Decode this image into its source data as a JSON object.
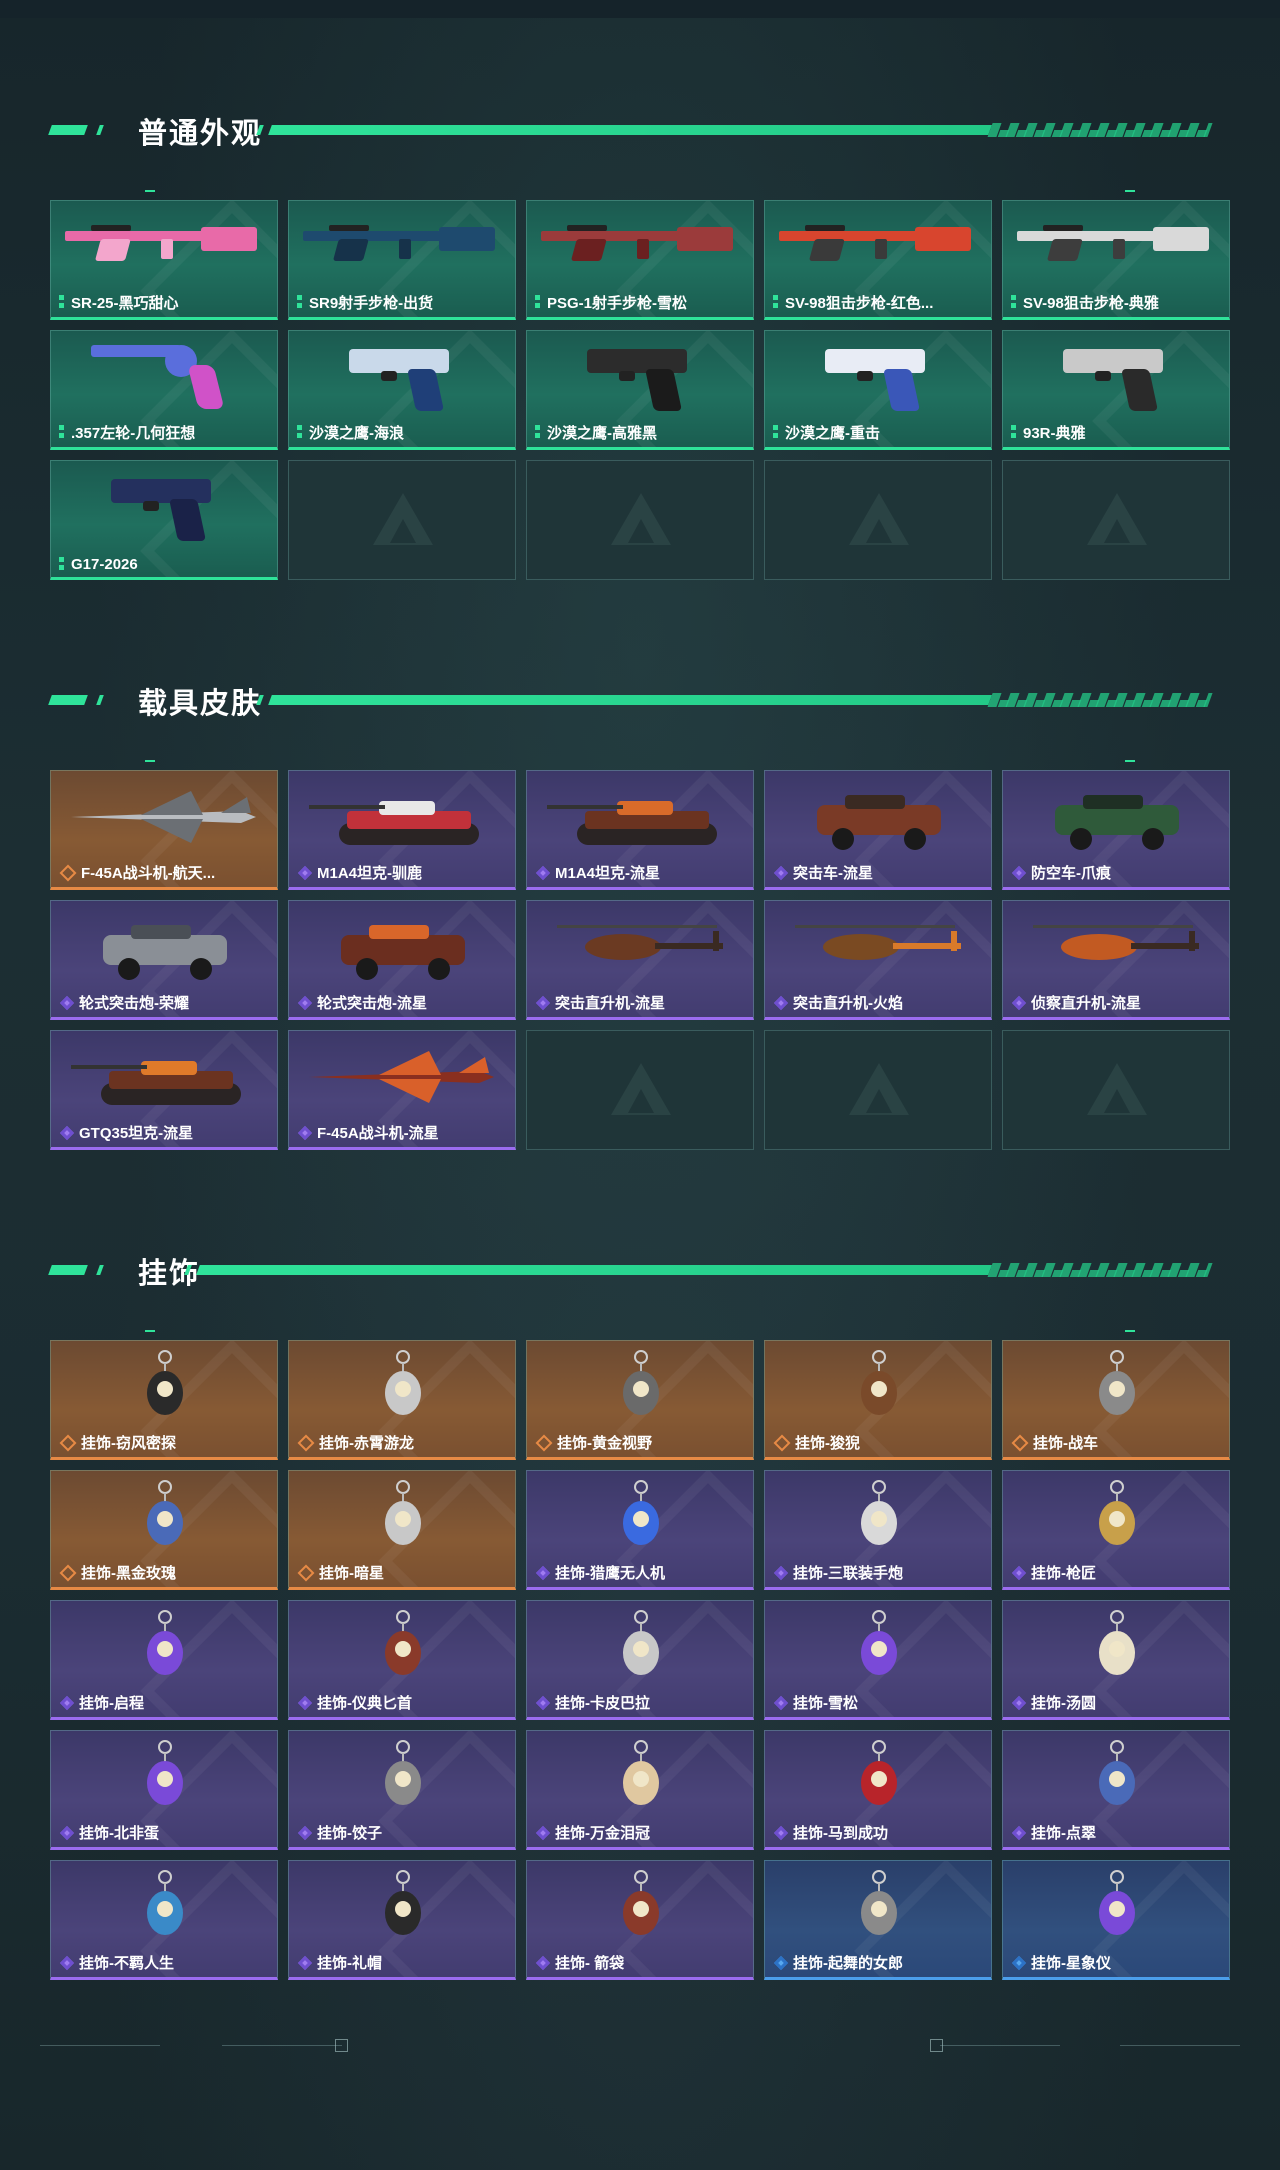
{
  "sections": [
    {
      "title": "普通外观",
      "items": [
        {
          "label": "SR-25-黑巧甜心",
          "rarity": "green",
          "icon": "rifle-pink-icon"
        },
        {
          "label": "SR9射手步枪-出货",
          "rarity": "green",
          "icon": "rifle-blue-icon"
        },
        {
          "label": "PSG-1射手步枪-雪松",
          "rarity": "green",
          "icon": "rifle-red-icon"
        },
        {
          "label": "SV-98狙击步枪-红色...",
          "rarity": "green",
          "icon": "sniper-red-icon"
        },
        {
          "label": "SV-98狙击步枪-典雅",
          "rarity": "green",
          "icon": "sniper-white-icon"
        },
        {
          "label": ".357左轮-几何狂想",
          "rarity": "green",
          "icon": "revolver-icon"
        },
        {
          "label": "沙漠之鹰-海浪",
          "rarity": "green",
          "icon": "pistol-wave-icon"
        },
        {
          "label": "沙漠之鹰-高雅黑",
          "rarity": "green",
          "icon": "pistol-black-icon"
        },
        {
          "label": "沙漠之鹰-重击",
          "rarity": "green",
          "icon": "pistol-blue-white-icon"
        },
        {
          "label": "93R-典雅",
          "rarity": "green",
          "icon": "pistol-silver-icon"
        },
        {
          "label": "G17-2026",
          "rarity": "green",
          "icon": "pistol-navy-icon"
        },
        {
          "label": "",
          "rarity": "empty"
        },
        {
          "label": "",
          "rarity": "empty"
        },
        {
          "label": "",
          "rarity": "empty"
        },
        {
          "label": "",
          "rarity": "empty"
        }
      ]
    },
    {
      "title": "载具皮肤",
      "items": [
        {
          "label": "F-45A战斗机-航天...",
          "rarity": "orange",
          "icon": "jet-icon"
        },
        {
          "label": "M1A4坦克-驯鹿",
          "rarity": "purple",
          "icon": "tank-red-icon"
        },
        {
          "label": "M1A4坦克-流星",
          "rarity": "purple",
          "icon": "tank-fire-icon"
        },
        {
          "label": "突击车-流星",
          "rarity": "purple",
          "icon": "assault-vehicle-icon"
        },
        {
          "label": "防空车-爪痕",
          "rarity": "purple",
          "icon": "aa-vehicle-icon"
        },
        {
          "label": "轮式突击炮-荣耀",
          "rarity": "purple",
          "icon": "wheeled-gun-icon"
        },
        {
          "label": "轮式突击炮-流星",
          "rarity": "purple",
          "icon": "wheeled-gun-fire-icon"
        },
        {
          "label": "突击直升机-流星",
          "rarity": "purple",
          "icon": "helicopter-icon"
        },
        {
          "label": "突击直升机-火焰",
          "rarity": "purple",
          "icon": "helicopter-flame-icon"
        },
        {
          "label": "侦察直升机-流星",
          "rarity": "purple",
          "icon": "scout-helicopter-icon"
        },
        {
          "label": "GTQ35坦克-流星",
          "rarity": "purple",
          "icon": "tank-gtq-icon"
        },
        {
          "label": "F-45A战斗机-流星",
          "rarity": "purple",
          "icon": "jet-fire-icon"
        },
        {
          "label": "",
          "rarity": "empty"
        },
        {
          "label": "",
          "rarity": "empty"
        },
        {
          "label": "",
          "rarity": "empty"
        }
      ]
    },
    {
      "title": "挂饰",
      "items": [
        {
          "label": "挂饰-窃风密探",
          "rarity": "orange",
          "icon": "charm-figure-icon"
        },
        {
          "label": "挂饰-赤霄游龙",
          "rarity": "orange",
          "icon": "charm-dragon-icon"
        },
        {
          "label": "挂饰-黄金视野",
          "rarity": "orange",
          "icon": "charm-gold-icon"
        },
        {
          "label": "挂饰-狻猊",
          "rarity": "orange",
          "icon": "charm-lion-icon"
        },
        {
          "label": "挂饰-战车",
          "rarity": "orange",
          "icon": "charm-chariot-icon"
        },
        {
          "label": "挂饰-黑金玫瑰",
          "rarity": "orange",
          "icon": "charm-rose-icon"
        },
        {
          "label": "挂饰-暗星",
          "rarity": "orange",
          "icon": "charm-darkstar-icon"
        },
        {
          "label": "挂饰-猎鹰无人机",
          "rarity": "purple",
          "icon": "charm-drone-icon"
        },
        {
          "label": "挂饰-三联装手炮",
          "rarity": "purple",
          "icon": "charm-cannon-icon"
        },
        {
          "label": "挂饰-枪匠",
          "rarity": "purple",
          "icon": "charm-gunsmith-icon"
        },
        {
          "label": "挂饰-启程",
          "rarity": "purple",
          "icon": "charm-ring-icon"
        },
        {
          "label": "挂饰-仪典匕首",
          "rarity": "purple",
          "icon": "charm-dagger-icon"
        },
        {
          "label": "挂饰-卡皮巴拉",
          "rarity": "purple",
          "icon": "charm-capybara-icon"
        },
        {
          "label": "挂饰-雪松",
          "rarity": "purple",
          "icon": "charm-tree-icon"
        },
        {
          "label": "挂饰-汤圆",
          "rarity": "purple",
          "icon": "charm-dumpling-icon"
        },
        {
          "label": "挂饰-北非蛋",
          "rarity": "purple",
          "icon": "charm-egg-icon"
        },
        {
          "label": "挂饰-饺子",
          "rarity": "purple",
          "icon": "charm-jiaozi-icon"
        },
        {
          "label": "挂饰-万金泪冠",
          "rarity": "purple",
          "icon": "charm-crown-icon"
        },
        {
          "label": "挂饰-马到成功",
          "rarity": "purple",
          "icon": "charm-horse-icon"
        },
        {
          "label": "挂饰-点翠",
          "rarity": "purple",
          "icon": "charm-kingfisher-icon"
        },
        {
          "label": "挂饰-不羁人生",
          "rarity": "purple",
          "icon": "charm-shoe-icon"
        },
        {
          "label": "挂饰-礼帽",
          "rarity": "purple",
          "icon": "charm-hat-icon"
        },
        {
          "label": "挂饰- 箭袋",
          "rarity": "purple",
          "icon": "charm-quiver-icon"
        },
        {
          "label": "挂饰-起舞的女郎",
          "rarity": "blue",
          "icon": "charm-dancer-icon"
        },
        {
          "label": "挂饰-星象仪",
          "rarity": "blue",
          "icon": "charm-astrolabe-icon"
        }
      ]
    }
  ],
  "colors": {
    "accent": "#2fe39a",
    "green": "#20705f",
    "orange": "#875a34",
    "purple": "#4b447a",
    "blue": "#31507e"
  }
}
